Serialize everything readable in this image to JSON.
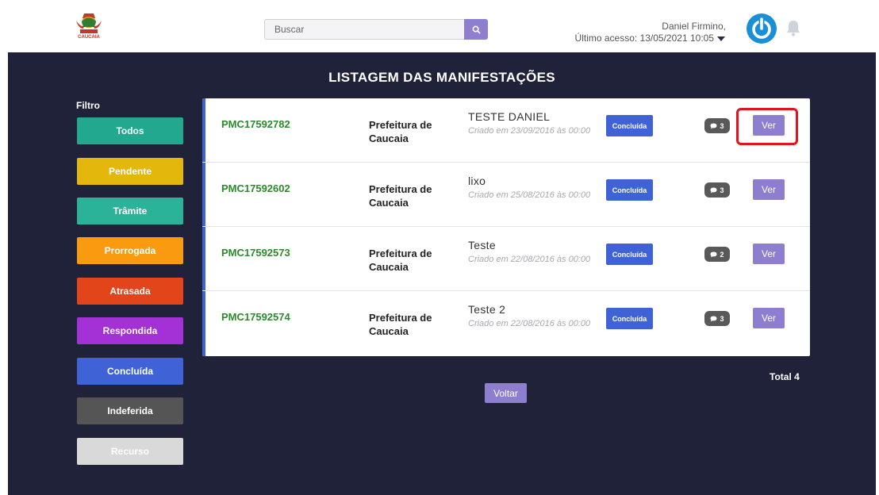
{
  "header": {
    "logo_text": "CAUCAIA",
    "search": {
      "placeholder": "Buscar",
      "value": ""
    },
    "user": {
      "name": "Daniel Firmino,",
      "last_access": "Último acesso: 13/05/2021 10:05"
    }
  },
  "main": {
    "title": "LISTAGEM DAS MANIFESTAÇÕES",
    "filter": {
      "label": "Filtro",
      "buttons": [
        {
          "label": "Todos",
          "color": "#22a88f"
        },
        {
          "label": "Pendente",
          "color": "#e3b70c"
        },
        {
          "label": "Trâmite",
          "color": "#2bb39a"
        },
        {
          "label": "Prorrogada",
          "color": "#fa9a0e"
        },
        {
          "label": "Atrasada",
          "color": "#e14519"
        },
        {
          "label": "Respondida",
          "color": "#a431d6"
        },
        {
          "label": "Concluída",
          "color": "#3f63d6"
        },
        {
          "label": "Indeferida",
          "color": "#555555"
        },
        {
          "label": "Recurso",
          "color": "#d9d9d9"
        }
      ]
    },
    "rows": [
      {
        "protocol": "PMC17592782",
        "org": "Prefeitura de Caucaia",
        "subject": "TESTE DANIEL",
        "created": "Criado em 23/09/2016 às 00:00",
        "status": "Concluída",
        "comments": "3",
        "action": "Ver"
      },
      {
        "protocol": "PMC17592602",
        "org": "Prefeitura de Caucaia",
        "subject": "lixo",
        "created": "Criado em 25/08/2016 às 00:00",
        "status": "Concluída",
        "comments": "3",
        "action": "Ver"
      },
      {
        "protocol": "PMC17592573",
        "org": "Prefeitura de Caucaia",
        "subject": "Teste",
        "created": "Criado em 22/08/2016 às 00:00",
        "status": "Concluída",
        "comments": "2",
        "action": "Ver"
      },
      {
        "protocol": "PMC17592574",
        "org": "Prefeitura de Caucaia",
        "subject": "Teste 2",
        "created": "Criado em 22/08/2016 às 00:00",
        "status": "Concluída",
        "comments": "3",
        "action": "Ver"
      }
    ],
    "total": "Total 4",
    "back_label": "Voltar"
  },
  "colors": {
    "background_dark": "#1f2238",
    "accent_purple": "#8e7ed0",
    "status_blue": "#3f63d6",
    "protocol_green": "#2b8a2b",
    "highlight_red": "#e8121e"
  }
}
